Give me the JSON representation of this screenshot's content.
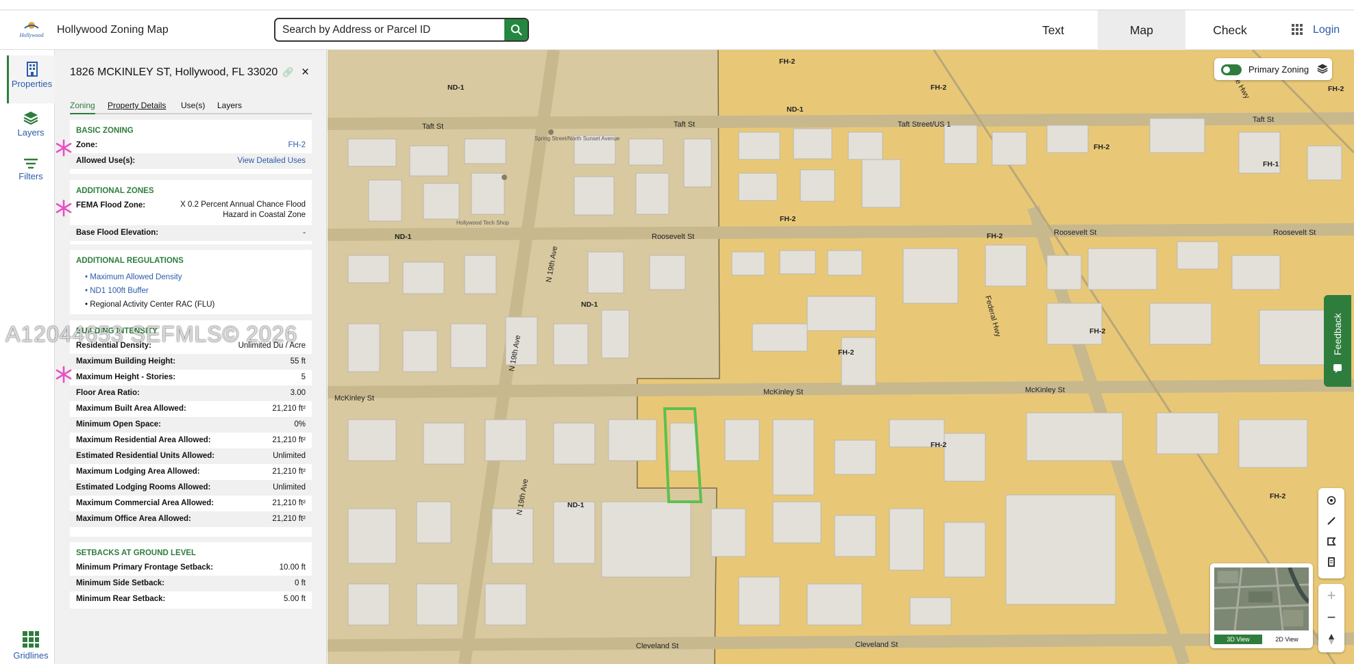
{
  "header": {
    "app_title": "Hollywood Zoning Map",
    "logo_text": "Hollywood",
    "search_placeholder": "Search by Address or Parcel ID",
    "tabs": [
      {
        "label": "Text"
      },
      {
        "label": "Map",
        "active": true
      },
      {
        "label": "Check"
      }
    ],
    "login_label": "Login"
  },
  "left_nav": {
    "items": [
      {
        "label": "Properties",
        "icon": "building-icon",
        "active": true
      },
      {
        "label": "Layers",
        "icon": "layers-icon"
      },
      {
        "label": "Filters",
        "icon": "filter-icon"
      },
      {
        "label": "Gridlines",
        "icon": "grid-icon"
      }
    ]
  },
  "panel": {
    "address": "1826 MCKINLEY ST, Hollywood, FL 33020",
    "close_label": "×",
    "tabs": [
      "Zoning",
      "Property Details",
      "Use(s)",
      "Layers"
    ],
    "basic_zoning": {
      "title": "BASIC ZONING",
      "zone_label": "Zone:",
      "zone_value": "FH-2",
      "uses_label": "Allowed Use(s):",
      "uses_value": "View Detailed Uses"
    },
    "additional_zones": {
      "title": "ADDITIONAL ZONES",
      "fema_label": "FEMA Flood Zone:",
      "fema_value": "X 0.2 Percent Annual Chance Flood Hazard in Coastal Zone",
      "bfe_label": "Base Flood Elevation:",
      "bfe_value": "-"
    },
    "additional_regulations": {
      "title": "ADDITIONAL REGULATIONS",
      "items": [
        "Maximum Allowed Density",
        "ND1 100ft Buffer",
        "Regional Activity Center RAC (FLU)"
      ]
    },
    "building_intensity": {
      "title": "BUILDING INTENSITY",
      "rows": [
        {
          "k": "Residential Density:",
          "v": "Unlimited Du / Acre"
        },
        {
          "k": "Maximum Building Height:",
          "v": "55 ft"
        },
        {
          "k": "Maximum Height - Stories:",
          "v": "5"
        },
        {
          "k": "Floor Area Ratio:",
          "v": "3.00"
        },
        {
          "k": "Maximum Built Area Allowed:",
          "v": "21,210 ft²"
        },
        {
          "k": "Minimum Open Space:",
          "v": "0%"
        },
        {
          "k": "Maximum Residential Area Allowed:",
          "v": "21,210 ft²"
        },
        {
          "k": "Estimated Residential Units Allowed:",
          "v": "Unlimited"
        },
        {
          "k": "Maximum Lodging Area Allowed:",
          "v": "21,210 ft²"
        },
        {
          "k": "Estimated Lodging Rooms Allowed:",
          "v": "Unlimited"
        },
        {
          "k": "Maximum Commercial Area Allowed:",
          "v": "21,210 ft²"
        },
        {
          "k": "Maximum Office Area Allowed:",
          "v": "21,210 ft²"
        }
      ]
    },
    "setbacks": {
      "title": "SETBACKS AT GROUND LEVEL",
      "rows": [
        {
          "k": "Minimum Primary Frontage Setback:",
          "v": "10.00 ft"
        },
        {
          "k": "Minimum Side Setback:",
          "v": "0 ft"
        },
        {
          "k": "Minimum Rear Setback:",
          "v": "5.00 ft"
        }
      ]
    }
  },
  "watermark": "A12044653 SEFMLS© 2026",
  "map": {
    "primary_zoning_label": "Primary Zoning",
    "feedback_label": "Feedback",
    "mini_3d": "3D View",
    "mini_2d": "2D View",
    "streets": [
      "Taft St",
      "Taft St",
      "Taft Street/US 1",
      "Taft St",
      "Roosevelt St",
      "Roosevelt St",
      "Roosevelt St",
      "McKinley St",
      "McKinley St",
      "McKinley St",
      "Cleveland St",
      "Cleveland St",
      "N 19th Ave",
      "N 19th Ave",
      "N 19th Ave",
      "Federal Hwy",
      "N Dixie Hwy"
    ],
    "zones": [
      "ND-1",
      "ND-1",
      "ND-1",
      "ND-1",
      "ND-1",
      "FH-2",
      "FH-2",
      "FH-2",
      "FH-2",
      "FH-2",
      "FH-2",
      "FH-2",
      "FH-2",
      "FH-2",
      "FH-1",
      "FH-2"
    ],
    "pois": [
      "Hollywood Tech Shop",
      "Spring Street/North Sunset Avenue"
    ],
    "colors": {
      "nd1": "#d8c9a0",
      "fh2": "#e8c877",
      "selected": "#5cc04e",
      "accent": "#2e7d3c"
    }
  }
}
